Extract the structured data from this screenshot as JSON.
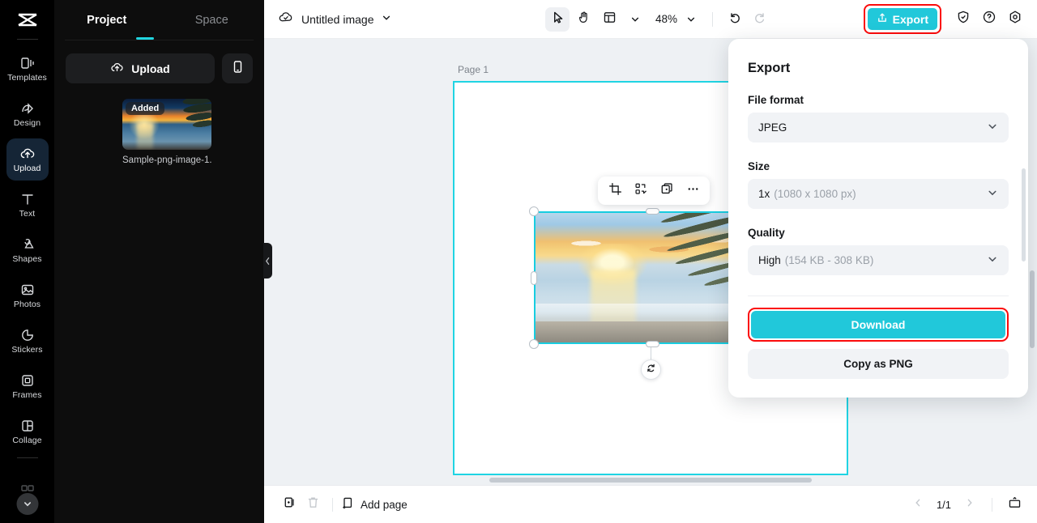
{
  "colors": {
    "accent": "#21c8da",
    "highlight": "#fb0b0b",
    "rail_bg": "#000000",
    "panel_bg": "#0d0d0d",
    "canvas_bg": "#eef1f4",
    "selection": "#18cde0"
  },
  "rail": {
    "logo": "capcut-logo",
    "items": [
      {
        "label": "Templates",
        "icon": "templates-icon",
        "active": false
      },
      {
        "label": "Design",
        "icon": "design-icon",
        "active": false
      },
      {
        "label": "Upload",
        "icon": "upload-cloud-icon",
        "active": true
      },
      {
        "label": "Text",
        "icon": "text-icon",
        "active": false
      },
      {
        "label": "Shapes",
        "icon": "shapes-icon",
        "active": false
      },
      {
        "label": "Photos",
        "icon": "photos-icon",
        "active": false
      },
      {
        "label": "Stickers",
        "icon": "stickers-icon",
        "active": false
      },
      {
        "label": "Frames",
        "icon": "frames-icon",
        "active": false
      },
      {
        "label": "Collage",
        "icon": "collage-icon",
        "active": false
      }
    ],
    "more_icon": "chevron-down-icon"
  },
  "panel": {
    "tabs": [
      {
        "label": "Project",
        "active": true
      },
      {
        "label": "Space",
        "active": false
      }
    ],
    "upload_label": "Upload",
    "upload_icon": "upload-cloud-icon",
    "phone_icon": "mobile-phone-icon",
    "asset": {
      "badge": "Added",
      "name": "Sample-png-image-1..."
    },
    "collapse_icon": "chevron-left-icon"
  },
  "toolbar": {
    "save_icon": "cloud-check-icon",
    "doc_title": "Untitled image",
    "doc_caret": "chevron-down-icon",
    "tools": [
      {
        "name": "select-tool",
        "icon": "cursor-arrow-icon",
        "selected": true
      },
      {
        "name": "hand-tool",
        "icon": "hand-icon",
        "selected": false
      },
      {
        "name": "layout-tool",
        "icon": "layout-panel-icon",
        "selected": false
      }
    ],
    "layout_caret": "chevron-down-icon",
    "zoom_value": "48%",
    "zoom_caret": "chevron-down-icon",
    "undo_icon": "undo-arrow-icon",
    "redo_icon": "redo-arrow-icon",
    "export_label": "Export",
    "export_icon": "share-upload-icon",
    "shield_icon": "shield-check-icon",
    "help_icon": "question-circle-icon",
    "settings_icon": "gear-hexagon-icon"
  },
  "canvas": {
    "page_label": "Page 1",
    "float_toolbar": [
      {
        "name": "crop-button",
        "icon": "crop-icon"
      },
      {
        "name": "remove-background-button",
        "icon": "magic-shapes-icon"
      },
      {
        "name": "duplicate-button",
        "icon": "duplicate-icon"
      },
      {
        "name": "more-options-button",
        "icon": "ellipsis-icon"
      }
    ],
    "rotate_icon": "rotate-icon"
  },
  "bottombar": {
    "duplicate_page_icon": "duplicate-page-icon",
    "delete_page_icon": "trash-icon",
    "add_page_label": "Add page",
    "add_page_icon": "add-page-icon",
    "prev_icon": "chevron-left-icon",
    "page_indicator": "1/1",
    "next_icon": "chevron-right-icon",
    "present_icon": "present-icon"
  },
  "export_panel": {
    "title": "Export",
    "file_format": {
      "label": "File format",
      "value": "JPEG",
      "caret": "chevron-down-icon"
    },
    "size": {
      "label": "Size",
      "value": "1x",
      "detail": "(1080 x 1080 px)",
      "caret": "chevron-down-icon"
    },
    "quality": {
      "label": "Quality",
      "value": "High",
      "detail": "(154 KB - 308 KB)",
      "caret": "chevron-down-icon"
    },
    "download_label": "Download",
    "copy_label": "Copy as PNG"
  }
}
